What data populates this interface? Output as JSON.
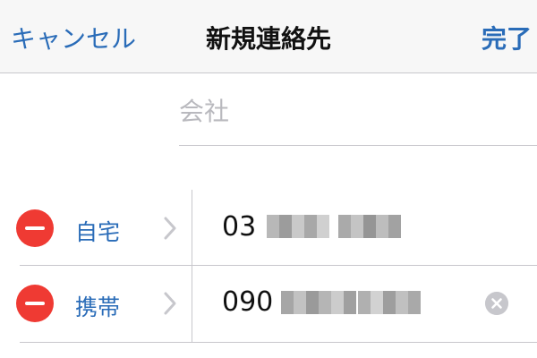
{
  "navbar": {
    "cancel_label": "キャンセル",
    "title": "新規連絡先",
    "done_label": "完了"
  },
  "company_field": {
    "placeholder": "会社",
    "value": ""
  },
  "phones": [
    {
      "label": "自宅",
      "value": "03"
    },
    {
      "label": "携帯",
      "value": "090"
    }
  ],
  "icons": {
    "delete": "minus-circle-icon",
    "chevron": "chevron-right-icon",
    "clear": "clear-x-circle-icon"
  },
  "colors": {
    "accent": "#2a6cb8",
    "delete_red": "#ef3a33",
    "separator": "#c8c7cc",
    "placeholder": "#b9b9be"
  }
}
